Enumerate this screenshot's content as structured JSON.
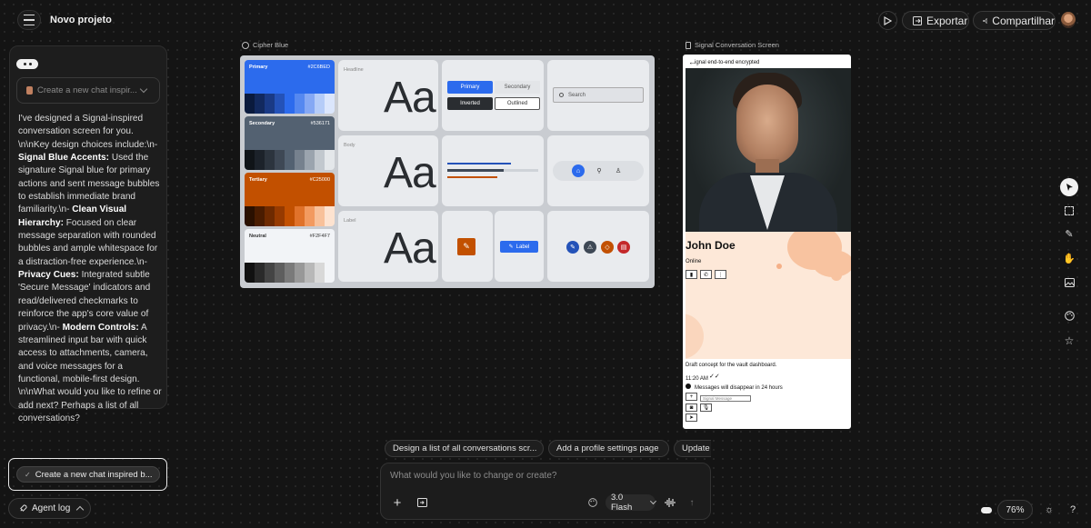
{
  "header": {
    "project_title": "Novo projeto",
    "export_label": "Exportar",
    "share_label": "Compartilhar"
  },
  "chat": {
    "input_placeholder": "Create a new chat inspir...",
    "message_parts": [
      {
        "text": "I've designed a Signal-inspired conversation screen for you. \\n\\nKey design choices include:\\n- ",
        "bold": false
      },
      {
        "text": "Signal Blue Accents:",
        "bold": true
      },
      {
        "text": " Used the signature Signal blue for primary actions and sent message bubbles to establish immediate brand familiarity.\\n- ",
        "bold": false
      },
      {
        "text": "Clean Visual Hierarchy:",
        "bold": true
      },
      {
        "text": " Focused on clear message separation with rounded bubbles and ample whitespace for a distraction-free experience.\\n- ",
        "bold": false
      },
      {
        "text": "Privacy Cues:",
        "bold": true
      },
      {
        "text": " Integrated subtle 'Secure Message' indicators and read/delivered checkmarks to reinforce the app's core value of privacy.\\n- ",
        "bold": false
      },
      {
        "text": "Modern Controls:",
        "bold": true
      },
      {
        "text": " A streamlined input bar with quick access to attachments, camera, and voice messages for a functional, mobile-first design. \\n\\nWhat would you like to refine or add next? Perhaps a list of all conversations?",
        "bold": false
      }
    ],
    "suggestion_label": "Create a new chat inspired b...",
    "agent_log_label": "Agent log"
  },
  "design_system": {
    "label": "Cipher Blue",
    "swatches": [
      {
        "name": "Primary",
        "hex": "#2C6BED",
        "color": "#2c6bed",
        "text_color": "#ffffff",
        "shades": [
          "#0a1a3d",
          "#12295e",
          "#1a3a85",
          "#2452b8",
          "#2c6bed",
          "#5588f0",
          "#85a8f4",
          "#b5ccf8",
          "#dbe6fc"
        ]
      },
      {
        "name": "Secondary",
        "hex": "#536171",
        "color": "#536171",
        "text_color": "#ffffff",
        "shades": [
          "#101418",
          "#1c222a",
          "#2c343e",
          "#3e4855",
          "#536171",
          "#76818e",
          "#9ba4ae",
          "#c2c8ce",
          "#e4e7ea"
        ]
      },
      {
        "name": "Tertiary",
        "hex": "#C25000",
        "color": "#c25000",
        "text_color": "#ffffff",
        "shades": [
          "#2a1000",
          "#4a1c00",
          "#6e2a00",
          "#963a00",
          "#c25000",
          "#e0722a",
          "#f29a60",
          "#f8c19a",
          "#fde3d0"
        ]
      },
      {
        "name": "Neutral",
        "hex": "#F2F4F7",
        "color": "#f2f4f7",
        "text_color": "#333333",
        "shades": [
          "#111111",
          "#2a2a2a",
          "#444444",
          "#5e5e5e",
          "#7a7a7a",
          "#989898",
          "#b8b8b8",
          "#d8d8d8",
          "#f2f4f7"
        ]
      }
    ],
    "type_labels": [
      "Headline",
      "Body",
      "Label"
    ],
    "type_sample": "Aa",
    "buttons": {
      "primary": "Primary",
      "secondary": "Secondary",
      "inverted": "Inverted",
      "outlined": "Outlined"
    },
    "search_placeholder": "Search",
    "label_chip": "Label"
  },
  "phone_screen": {
    "label": "Signal Conversation Screen",
    "encrypted_text": "ignal end-to-end encrypted",
    "contact_name": "John Doe",
    "status": "Online",
    "message_text": "Draft concept for the vault dashboard.",
    "message_time": "11:20 AM",
    "disappearing_notice": "Messages will disappear in 24 hours",
    "input_placeholder": "Signal Message"
  },
  "suggestions": [
    {
      "label": "Design a list of all conversations scr...",
      "num": "1"
    },
    {
      "label": "Add a profile settings page",
      "num": "2"
    },
    {
      "label": "Update n",
      "num": ""
    }
  ],
  "composer": {
    "placeholder": "What would you like to change or create?",
    "model_label": "3.0 Flash"
  },
  "footer": {
    "zoom": "76%"
  }
}
